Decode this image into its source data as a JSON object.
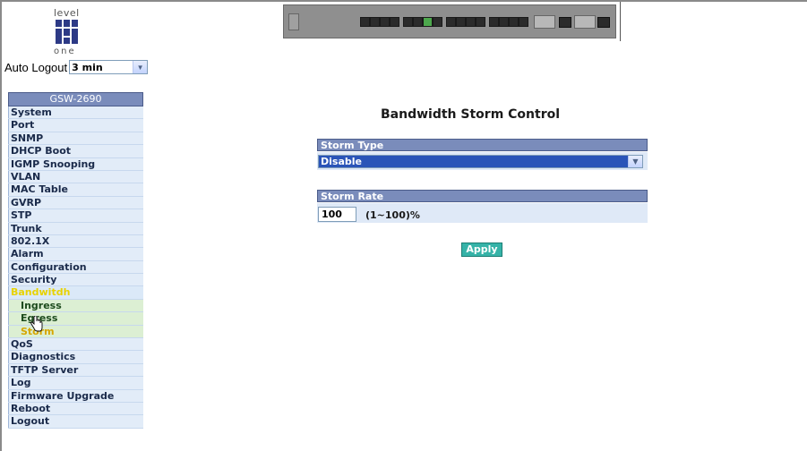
{
  "logo": {
    "brand_top": "level",
    "brand_bottom": "one"
  },
  "autologout": {
    "label": "Auto Logout",
    "value": "3 min"
  },
  "sidebar": {
    "title": "GSW-2690",
    "items": [
      {
        "label": "System"
      },
      {
        "label": "Port"
      },
      {
        "label": "SNMP"
      },
      {
        "label": "DHCP Boot"
      },
      {
        "label": "IGMP Snooping"
      },
      {
        "label": "VLAN"
      },
      {
        "label": "MAC Table"
      },
      {
        "label": "GVRP"
      },
      {
        "label": "STP"
      },
      {
        "label": "Trunk"
      },
      {
        "label": "802.1X"
      },
      {
        "label": "Alarm"
      },
      {
        "label": "Configuration"
      },
      {
        "label": "Security"
      },
      {
        "label": "Bandwitdh"
      },
      {
        "label": "Ingress"
      },
      {
        "label": "Egress"
      },
      {
        "label": "Storm"
      },
      {
        "label": "QoS"
      },
      {
        "label": "Diagnostics"
      },
      {
        "label": "TFTP Server"
      },
      {
        "label": "Log"
      },
      {
        "label": "Firmware Upgrade"
      },
      {
        "label": "Reboot"
      },
      {
        "label": "Logout"
      }
    ]
  },
  "main": {
    "title": "Bandwidth Storm Control",
    "storm_type": {
      "header": "Storm Type",
      "value": "Disable"
    },
    "storm_rate": {
      "header": "Storm Rate",
      "value": "100",
      "hint": "(1~100)%"
    },
    "apply_label": "Apply"
  },
  "colors": {
    "header_bg": "#7a8cbb",
    "menu_bg": "#e2ecf8",
    "submenu_bg": "#dcefd3",
    "apply_bg": "#36b3a8",
    "select_bg": "#2a54b8"
  }
}
